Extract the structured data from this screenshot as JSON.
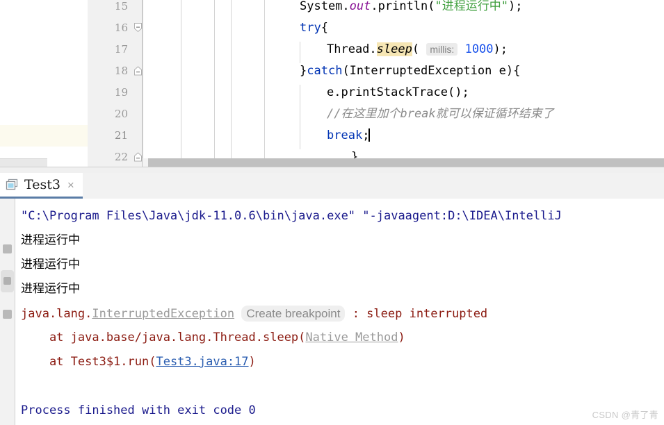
{
  "editor": {
    "gutter_lines": [
      {
        "num": "15",
        "fold": "none",
        "current": false
      },
      {
        "num": "16",
        "fold": "collapse",
        "current": false
      },
      {
        "num": "17",
        "fold": "none",
        "current": false
      },
      {
        "num": "18",
        "fold": "end",
        "current": false
      },
      {
        "num": "19",
        "fold": "none",
        "current": false
      },
      {
        "num": "20",
        "fold": "none",
        "current": false
      },
      {
        "num": "21",
        "fold": "none",
        "current": true
      },
      {
        "num": "22",
        "fold": "end",
        "current": false
      }
    ],
    "code_lines": [
      {
        "line": "15",
        "tokens": [
          {
            "t": "System",
            "k": "plain"
          },
          {
            "t": ".",
            "k": "plain"
          },
          {
            "t": "out",
            "k": "field"
          },
          {
            "t": ".println(",
            "k": "plain"
          },
          {
            "t": "\"进程运行中\"",
            "k": "str"
          },
          {
            "t": ");",
            "k": "plain"
          }
        ]
      },
      {
        "line": "16",
        "tokens": [
          {
            "t": "try",
            "k": "kw"
          },
          {
            "t": "{",
            "k": "plain"
          }
        ]
      },
      {
        "line": "17",
        "tokens": [
          {
            "t": "Thread.",
            "k": "plain"
          },
          {
            "t": "sleep",
            "k": "method"
          },
          {
            "t": "( ",
            "k": "plain"
          },
          {
            "t": "millis:",
            "k": "hint"
          },
          {
            "t": " ",
            "k": "plain"
          },
          {
            "t": "1000",
            "k": "num"
          },
          {
            "t": ");",
            "k": "plain"
          }
        ]
      },
      {
        "line": "18",
        "tokens": [
          {
            "t": "}",
            "k": "plain"
          },
          {
            "t": "catch",
            "k": "kw"
          },
          {
            "t": "(InterruptedException e){",
            "k": "plain"
          }
        ]
      },
      {
        "line": "19",
        "tokens": [
          {
            "t": "e.printStackTrace();",
            "k": "plain"
          }
        ]
      },
      {
        "line": "20",
        "tokens": [
          {
            "t": "//在这里加个break就可以保证循环结束了",
            "k": "comment"
          }
        ]
      },
      {
        "line": "21",
        "tokens": [
          {
            "t": "break",
            "k": "kw"
          },
          {
            "t": ";",
            "k": "plain"
          },
          {
            "t": "",
            "k": "caret"
          }
        ]
      },
      {
        "line": "22",
        "tokens": [
          {
            "t": "}",
            "k": "plain"
          }
        ]
      }
    ]
  },
  "run_panel": {
    "tab": {
      "label": "Test3",
      "close_label": "×",
      "icon": "console-window-icon"
    },
    "console_lines": [
      {
        "id": "cmdline",
        "segments": [
          {
            "t": "\"C:\\Program Files\\Java\\jdk-11.0.6\\bin\\java.exe\" \"-javaagent:D:\\IDEA\\IntelliJ",
            "k": "cmd"
          }
        ]
      },
      {
        "id": "out1",
        "segments": [
          {
            "t": "进程运行中",
            "k": "plain"
          }
        ]
      },
      {
        "id": "out2",
        "segments": [
          {
            "t": "进程运行中",
            "k": "plain"
          }
        ]
      },
      {
        "id": "out3",
        "segments": [
          {
            "t": "进程运行中",
            "k": "plain"
          }
        ]
      },
      {
        "id": "exception",
        "segments": [
          {
            "t": "java.lang.",
            "k": "err"
          },
          {
            "t": "InterruptedException",
            "k": "link-gray"
          },
          {
            "t": " ",
            "k": "err"
          },
          {
            "t": "Create breakpoint",
            "k": "badge"
          },
          {
            "t": " : ",
            "k": "err"
          },
          {
            "t": "sleep interrupted",
            "k": "err"
          }
        ]
      },
      {
        "id": "stack1",
        "segments": [
          {
            "t": "    at java.base/java.lang.Thread.sleep(",
            "k": "err"
          },
          {
            "t": "Native Method",
            "k": "link-gray"
          },
          {
            "t": ")",
            "k": "err"
          }
        ]
      },
      {
        "id": "stack2",
        "segments": [
          {
            "t": "    at Test3$1.run(",
            "k": "err"
          },
          {
            "t": "Test3.java:17",
            "k": "link-blue"
          },
          {
            "t": ")",
            "k": "err"
          }
        ]
      },
      {
        "id": "finished",
        "segments": [
          {
            "t": "Process finished with exit code 0",
            "k": "done"
          }
        ]
      }
    ]
  },
  "watermark": {
    "text": "CSDN @青了青"
  }
}
